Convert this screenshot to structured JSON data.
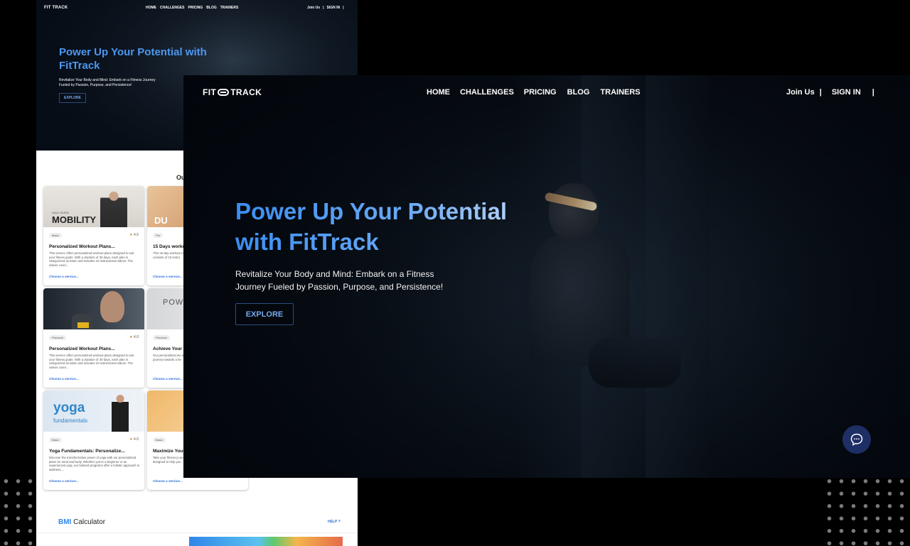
{
  "back_page": {
    "logo": "FIT TRACK",
    "nav": [
      "HOME",
      "CHALLENGES",
      "PRICING",
      "BLOG",
      "TRAINERS"
    ],
    "auth": {
      "join": "Join Us",
      "sep": "|",
      "signin": "SIGN IN",
      "sep2": "|"
    },
    "hero": {
      "title": "Power Up Your Potential with FitTrack",
      "subtitle": "Revitalize Your Body and Mind: Embark on a Fitness Journey Fueled by Passion, Purpose, and Persistence!",
      "cta": "EXPLORE"
    },
    "section_heading": "Ou",
    "cards": [
      {
        "img_word": "MOBILITY",
        "img_tiny": "DAILY BURN",
        "badge": "Basic",
        "rating": "4.5",
        "title": "Personalized Workout Plans...",
        "desc": "This service offers personalized workout plans designed to suit your fitness goals. With a duration of 30 days, each plan is categorized as basic and includes 10 instructional videos. The videos cover...",
        "link": "Choose a service..."
      },
      {
        "img_word": "DU",
        "img_tiny": "",
        "badge": "Pro",
        "rating": "",
        "title": "15 Days worko",
        "desc": "This 15-day workout routines tailored to spans over 30 days consists of 10 instru",
        "link": "Choose a service..."
      },
      {
        "img_word": "",
        "img_tiny": "",
        "badge": "Premium",
        "rating": "4.0",
        "title": "Personalized Workout Plans...",
        "desc": "This service offers personalized workout plans designed to suit your fitness goals. With a duration of 30 days, each plan is categorized as basic and includes 10 instructional videos. The videos cover...",
        "link": "Choose a service..."
      },
      {
        "img_word": "POW CAR",
        "img_tiny": "",
        "badge": "Premium",
        "rating": "",
        "title": "Achieve Your F",
        "desc": "Our personalized wo achieve your fitness tailored routines and journey towards a he",
        "link": "Choose a service..."
      },
      {
        "img_word": "yoga",
        "img_tiny": "fundamentals",
        "badge": "Basic",
        "rating": "4.0",
        "title": "Yoga Fundamentals: Personalize...",
        "desc": "Discover the transformative power of yoga with our personalized plans for mind and body. Whether you're a beginner or an experienced yogi, our tailored programs offer a holistic approach to wellness....",
        "link": "Choose a service..."
      },
      {
        "img_word": "",
        "img_tiny": "",
        "badge": "Basic",
        "rating": "",
        "title": "Maximize Your",
        "desc": "Take your fitness jo personalized workou newbie or a seasone designed to help you",
        "link": "Choose a service..."
      }
    ],
    "bmi": {
      "accent": "BMI",
      "rest": " Calculator",
      "help": "HELP ?"
    }
  },
  "front_page": {
    "logo_left": "FIT",
    "logo_right": "TRACK",
    "nav": [
      "HOME",
      "CHALLENGES",
      "PRICING",
      "BLOG",
      "TRAINERS"
    ],
    "auth": {
      "join": "Join Us",
      "sep": "|",
      "signin": "SIGN IN",
      "sep2": "|"
    },
    "hero": {
      "title_line1": "Power Up Your Potential",
      "title_line2": "with FitTrack",
      "subtitle_line1": "Revitalize Your Body and Mind: Embark on a Fitness",
      "subtitle_line2": "Journey Fueled by Passion, Purpose, and Persistence!",
      "cta": "EXPLORE"
    },
    "chat_icon": "chat-bubble-icon"
  },
  "colors": {
    "accent_blue": "#3b8ef2",
    "chat_button": "#1e2f66",
    "link_blue": "#2f6fd6",
    "star": "#c58a12"
  }
}
